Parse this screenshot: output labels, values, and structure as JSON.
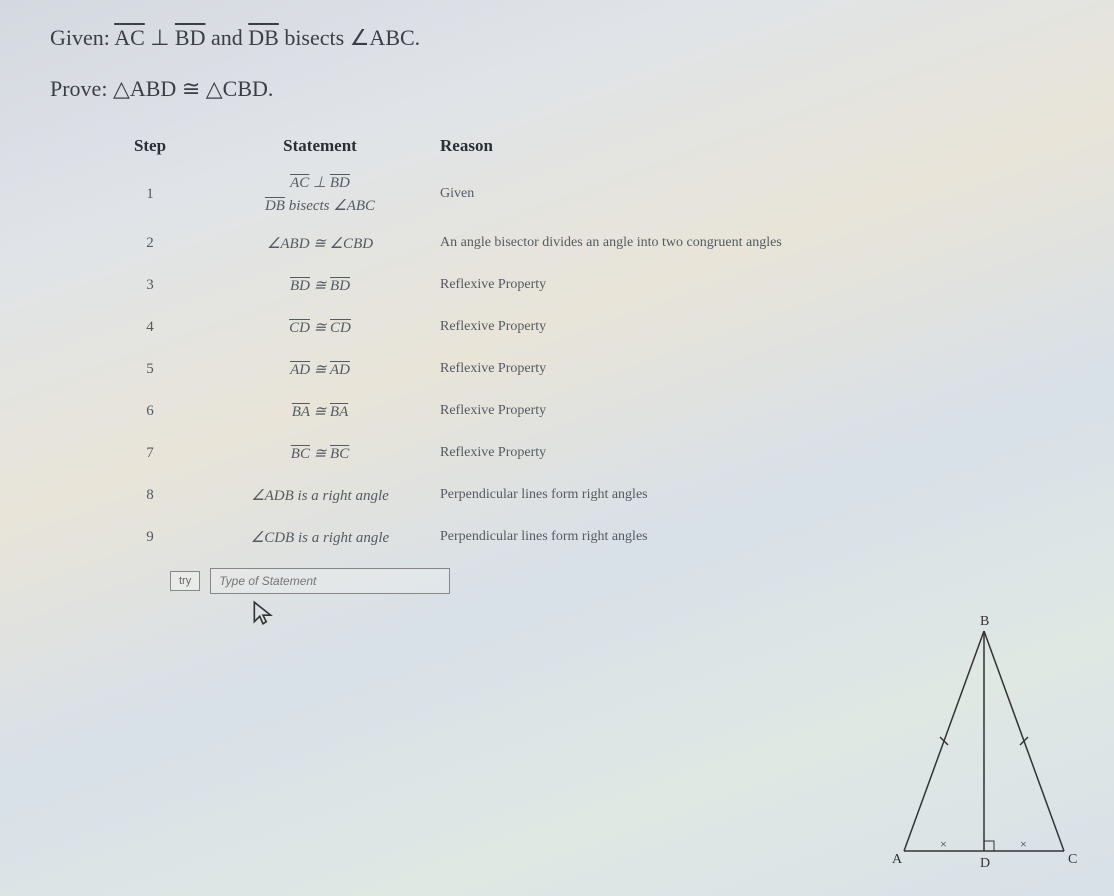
{
  "problem": {
    "given_label": "Given:",
    "given_ac": "AC",
    "given_perp": "⊥",
    "given_bd": "BD",
    "given_and": "and",
    "given_db": "DB",
    "given_bisects": "bisects",
    "given_angle": "∠ABC.",
    "prove_label": "Prove:",
    "prove_tri1": "△ABD",
    "prove_cong": "≅",
    "prove_tri2": "△CBD."
  },
  "headers": {
    "step": "Step",
    "statement": "Statement",
    "reason": "Reason"
  },
  "rows": [
    {
      "step": "1",
      "statement_a": "AC ⊥ BD",
      "ov_a1": "AC",
      "ov_a2": "BD",
      "sep_a": " ⊥ ",
      "statement_b": "DB bisects ∠ABC",
      "ov_b1": "DB",
      "tail_b": " bisects ∠ABC",
      "reason": "Given"
    },
    {
      "step": "2",
      "ov1": "",
      "mid": "∠ABD ≅ ∠CBD",
      "ov2": "",
      "reason": "An angle bisector divides an angle into two congruent angles"
    },
    {
      "step": "3",
      "ov1": "BD",
      "mid": " ≅ ",
      "ov2": "BD",
      "reason": "Reflexive Property"
    },
    {
      "step": "4",
      "ov1": "CD",
      "mid": " ≅ ",
      "ov2": "CD",
      "reason": "Reflexive Property"
    },
    {
      "step": "5",
      "ov1": "AD",
      "mid": " ≅ ",
      "ov2": "AD",
      "reason": "Reflexive Property"
    },
    {
      "step": "6",
      "ov1": "BA",
      "mid": " ≅ ",
      "ov2": "BA",
      "reason": "Reflexive Property"
    },
    {
      "step": "7",
      "ov1": "BC",
      "mid": " ≅ ",
      "ov2": "BC",
      "reason": "Reflexive Property"
    },
    {
      "step": "8",
      "plain": "∠ADB is a right angle",
      "reason": "Perpendicular lines form right angles"
    },
    {
      "step": "9",
      "plain": "∠CDB is a right angle",
      "reason": "Perpendicular lines form right angles"
    }
  ],
  "input": {
    "try_label": "try",
    "placeholder": "Type of Statement"
  },
  "diagram": {
    "A": "A",
    "B": "B",
    "C": "C",
    "D": "D"
  }
}
